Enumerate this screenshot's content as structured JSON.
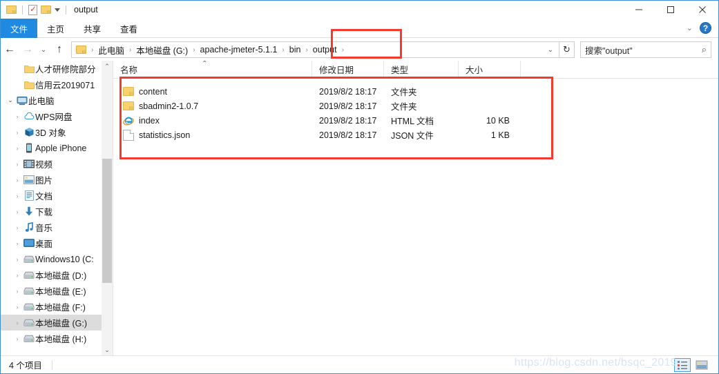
{
  "window": {
    "title": "output",
    "controls": {
      "minimize": "minimize-icon",
      "maximize": "maximize-icon",
      "close": "close-icon"
    },
    "quick_access": [
      "folder-icon",
      "properties-icon",
      "new-folder-icon",
      "customize-caret-icon"
    ]
  },
  "ribbon": {
    "tabs": [
      {
        "label": "文件",
        "active": true
      },
      {
        "label": "主页",
        "active": false
      },
      {
        "label": "共享",
        "active": false
      },
      {
        "label": "查看",
        "active": false
      }
    ],
    "expand_icon": "chevron-down-icon",
    "help_label": "?"
  },
  "address": {
    "back_icon": "←",
    "forward_icon": "→",
    "recent_icon": "⌄",
    "up_icon": "↑",
    "refresh_icon": "↻",
    "dropdown_icon": "⌄",
    "crumb_folder_icon": "folder-icon",
    "separator": "›",
    "crumbs": [
      "此电脑",
      "本地磁盘 (G:)",
      "apache-jmeter-5.1.1",
      "bin",
      "output"
    ]
  },
  "search": {
    "placeholder": "搜索\"output\"",
    "icon": "search-icon"
  },
  "sidebar": {
    "items": [
      {
        "label": "人才研修院部分",
        "icon": "folder",
        "expander": "",
        "indent": 1,
        "selected": false
      },
      {
        "label": "信用云2019071",
        "icon": "folder",
        "expander": "",
        "indent": 1,
        "selected": false
      },
      {
        "label": "此电脑",
        "icon": "pc",
        "expander": "⌄",
        "indent": 0,
        "selected": false
      },
      {
        "label": "WPS网盘",
        "icon": "cloud",
        "expander": "›",
        "indent": 1,
        "selected": false
      },
      {
        "label": "3D 对象",
        "icon": "cube",
        "expander": "›",
        "indent": 1,
        "selected": false
      },
      {
        "label": "Apple iPhone",
        "icon": "phone",
        "expander": "›",
        "indent": 1,
        "selected": false
      },
      {
        "label": "视频",
        "icon": "video",
        "expander": "›",
        "indent": 1,
        "selected": false
      },
      {
        "label": "图片",
        "icon": "picture",
        "expander": "›",
        "indent": 1,
        "selected": false
      },
      {
        "label": "文档",
        "icon": "document",
        "expander": "›",
        "indent": 1,
        "selected": false
      },
      {
        "label": "下载",
        "icon": "download",
        "expander": "›",
        "indent": 1,
        "selected": false
      },
      {
        "label": "音乐",
        "icon": "music",
        "expander": "›",
        "indent": 1,
        "selected": false
      },
      {
        "label": "桌面",
        "icon": "desktop",
        "expander": "›",
        "indent": 1,
        "selected": false
      },
      {
        "label": "Windows10 (C:",
        "icon": "drive",
        "expander": "›",
        "indent": 1,
        "selected": false
      },
      {
        "label": "本地磁盘 (D:)",
        "icon": "drive",
        "expander": "›",
        "indent": 1,
        "selected": false
      },
      {
        "label": "本地磁盘 (E:)",
        "icon": "drive",
        "expander": "›",
        "indent": 1,
        "selected": false
      },
      {
        "label": "本地磁盘 (F:)",
        "icon": "drive",
        "expander": "›",
        "indent": 1,
        "selected": false
      },
      {
        "label": "本地磁盘 (G:)",
        "icon": "drive",
        "expander": "›",
        "indent": 1,
        "selected": true
      },
      {
        "label": "本地磁盘 (H:)",
        "icon": "drive",
        "expander": "›",
        "indent": 1,
        "selected": false
      }
    ],
    "scroll_up_icon": "⌃",
    "scroll_down_icon": "⌄"
  },
  "filelist": {
    "columns": [
      "名称",
      "修改日期",
      "类型",
      "大小"
    ],
    "sort_indicator": "⌃",
    "rows": [
      {
        "name": "content",
        "date": "2019/8/2 18:17",
        "type": "文件夹",
        "size": "",
        "icon": "folder"
      },
      {
        "name": "sbadmin2-1.0.7",
        "date": "2019/8/2 18:17",
        "type": "文件夹",
        "size": "",
        "icon": "folder"
      },
      {
        "name": "index",
        "date": "2019/8/2 18:17",
        "type": "HTML 文档",
        "size": "10 KB",
        "icon": "ie"
      },
      {
        "name": "statistics.json",
        "date": "2019/8/2 18:17",
        "type": "JSON 文件",
        "size": "1 KB",
        "icon": "doc"
      }
    ]
  },
  "statusbar": {
    "item_count": "4 个项目",
    "view_details_icon": "details-view-icon",
    "view_large_icon": "large-icons-view-icon"
  },
  "watermark": "https://blog.csdn.net/bsqc_2019",
  "colors": {
    "accent": "#1f8ae0",
    "annotation": "#f4392f",
    "folder": "#f8d26e",
    "selection": "#dcdcdc"
  }
}
